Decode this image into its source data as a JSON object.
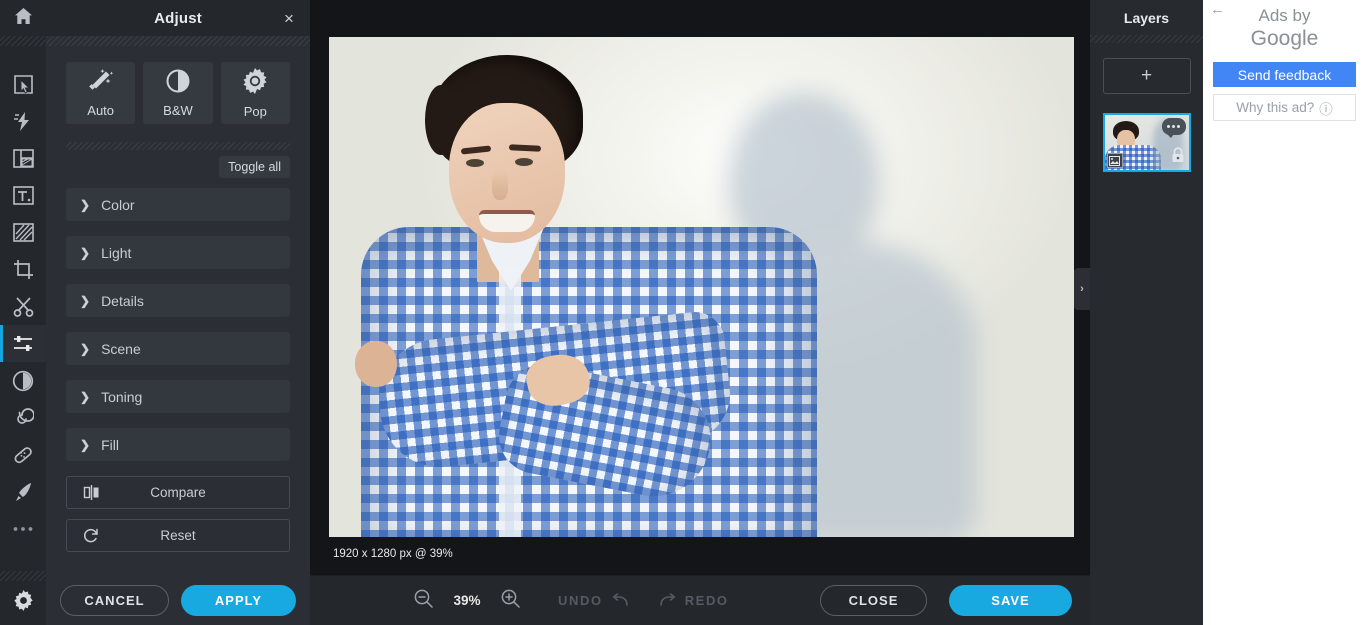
{
  "tool_rail": {
    "home": {
      "icon": "home-icon"
    },
    "tools": [
      {
        "name": "select-tool",
        "icon": "cursor-select-icon"
      },
      {
        "name": "effects-tool",
        "icon": "lightning-bolt-icon"
      },
      {
        "name": "frames-tool",
        "icon": "frame-layout-icon"
      },
      {
        "name": "text-tool",
        "icon": "text-box-icon"
      },
      {
        "name": "texture-tool",
        "icon": "hatched-square-icon"
      },
      {
        "name": "crop-tool",
        "icon": "crop-icon"
      },
      {
        "name": "cutout-tool",
        "icon": "scissors-icon"
      },
      {
        "name": "adjust-tool",
        "icon": "sliders-icon",
        "active": true
      },
      {
        "name": "contrast-tool",
        "icon": "contrast-circle-icon"
      },
      {
        "name": "swirl-tool",
        "icon": "spiral-icon"
      },
      {
        "name": "heal-tool",
        "icon": "bandage-icon"
      },
      {
        "name": "brush-tool",
        "icon": "paint-brush-icon"
      },
      {
        "name": "more-tools",
        "icon": "ellipsis-icon"
      }
    ],
    "settings": {
      "icon": "gear-icon"
    }
  },
  "adjust_panel": {
    "title": "Adjust",
    "close_label": "×",
    "quick_actions": [
      {
        "label": "Auto",
        "icon": "magic-wand-icon"
      },
      {
        "label": "B&W",
        "icon": "half-circle-icon"
      },
      {
        "label": "Pop",
        "icon": "sunburst-icon"
      }
    ],
    "toggle_all_label": "Toggle all",
    "sections": [
      {
        "label": "Color"
      },
      {
        "label": "Light"
      },
      {
        "label": "Details"
      },
      {
        "label": "Scene"
      },
      {
        "label": "Toning"
      },
      {
        "label": "Fill"
      }
    ],
    "utilities": [
      {
        "label": "Compare",
        "icon": "compare-split-icon"
      },
      {
        "label": "Reset",
        "icon": "reset-arrow-icon"
      }
    ],
    "footer": {
      "cancel_label": "CANCEL",
      "apply_label": "APPLY"
    },
    "accent_color": "#17a9e0"
  },
  "canvas": {
    "dimensions_badge": "1920 x 1280 px @ 39%",
    "collapse_chevron": "›",
    "image_alt": "Smiling young man with curly dark hair wearing a blue gingham checked shirt, leaning against a light wall with his shadow"
  },
  "bottom_bar": {
    "zoom_out_icon": "zoom-out-icon",
    "zoom_value": "39%",
    "zoom_in_icon": "zoom-in-icon",
    "undo_label": "UNDO",
    "redo_label": "REDO",
    "close_label": "CLOSE",
    "save_label": "SAVE"
  },
  "layers_panel": {
    "title": "Layers",
    "add_label": "+",
    "layer": {
      "menu_icon": "ellipsis-bubble-icon",
      "image_icon": "image-thumbnail-icon",
      "lock_icon": "lock-icon",
      "selected": true
    }
  },
  "ads_panel": {
    "back_icon": "back-arrow-icon",
    "ads_by": "Ads by",
    "brand": "Google",
    "feedback_label": "Send feedback",
    "why_label": "Why this ad?",
    "why_info_icon": "ⓘ",
    "feedback_color": "#4285f4"
  }
}
